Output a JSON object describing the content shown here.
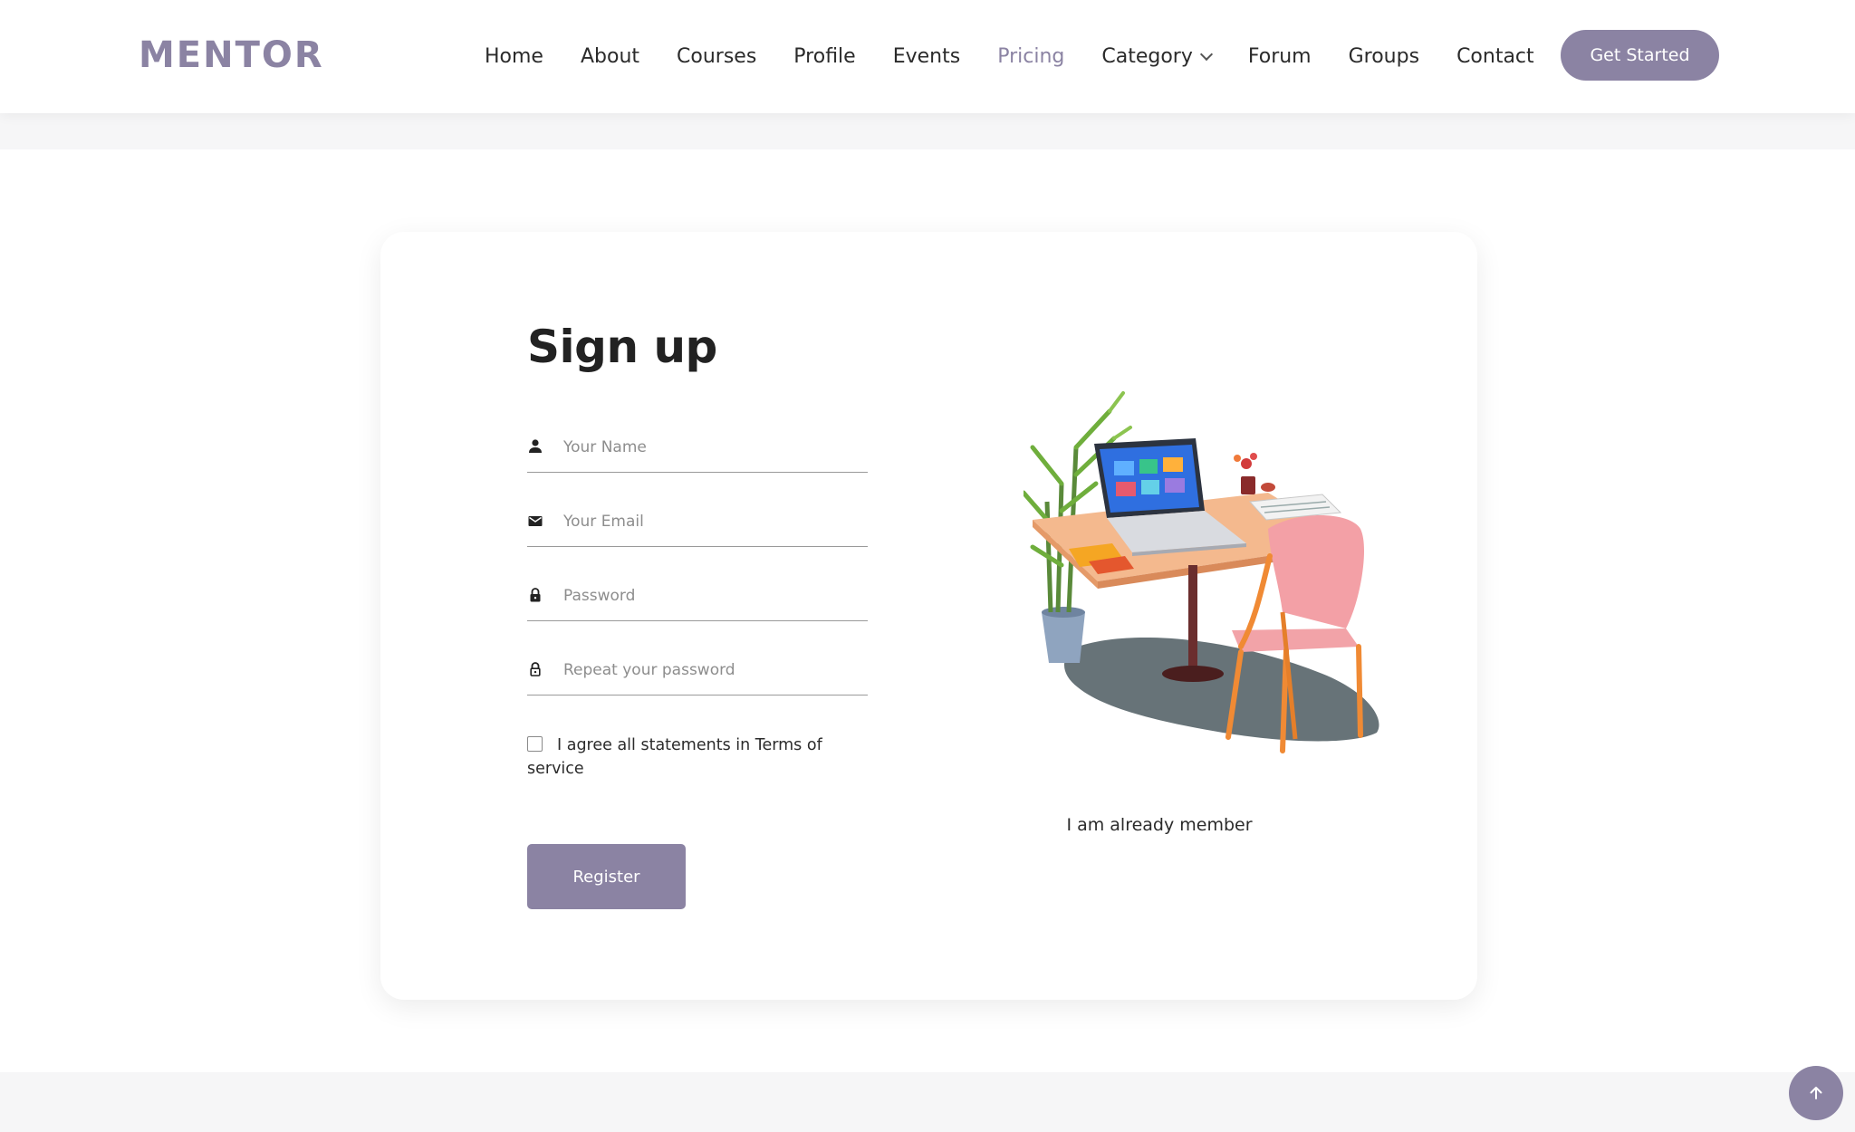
{
  "brand": {
    "logo": "MENTOR",
    "accent_color": "#8b83a3"
  },
  "nav": {
    "items": [
      {
        "label": "Home",
        "active": false
      },
      {
        "label": "About",
        "active": false
      },
      {
        "label": "Courses",
        "active": false
      },
      {
        "label": "Profile",
        "active": false
      },
      {
        "label": "Events",
        "active": false
      },
      {
        "label": "Pricing",
        "active": true
      },
      {
        "label": "Category",
        "active": false,
        "dropdown": true
      },
      {
        "label": "Forum",
        "active": false
      },
      {
        "label": "Groups",
        "active": false
      },
      {
        "label": "Contact",
        "active": false
      }
    ],
    "cta_label": "Get Started"
  },
  "signup": {
    "title": "Sign up",
    "fields": [
      {
        "icon": "person-icon",
        "placeholder": "Your Name",
        "value": ""
      },
      {
        "icon": "mail-icon",
        "placeholder": "Your Email",
        "value": ""
      },
      {
        "icon": "lock-icon",
        "placeholder": "Password",
        "value": ""
      },
      {
        "icon": "lock-outline-icon",
        "placeholder": "Repeat your password",
        "value": ""
      }
    ],
    "terms_label": "I agree all statements in Terms of service",
    "terms_checked": false,
    "register_label": "Register",
    "member_link": "I am already member",
    "illustration": "desk-laptop-chair-plant-illustration"
  },
  "back_to_top": {
    "icon": "arrow-up-icon"
  }
}
